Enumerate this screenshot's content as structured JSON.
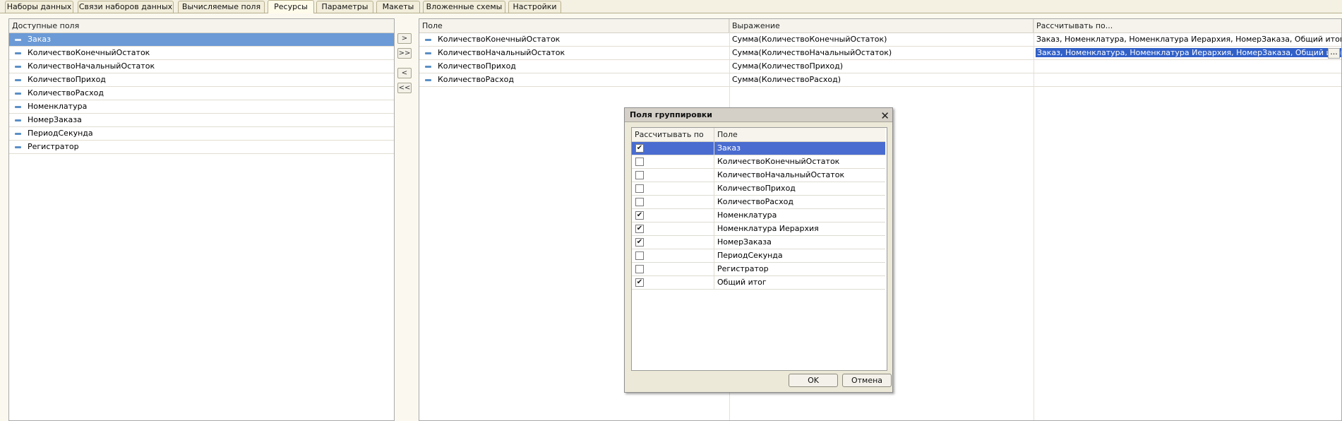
{
  "tabs": [
    {
      "label": "Наборы данных"
    },
    {
      "label": "Связи наборов данных"
    },
    {
      "label": "Вычисляемые поля"
    },
    {
      "label": "Ресурсы"
    },
    {
      "label": "Параметры"
    },
    {
      "label": "Макеты"
    },
    {
      "label": "Вложенные схемы"
    },
    {
      "label": "Настройки"
    }
  ],
  "available_fields": {
    "header": "Доступные поля",
    "items": [
      {
        "label": "Заказ"
      },
      {
        "label": "КоличествоКонечныйОстаток"
      },
      {
        "label": "КоличествоНачальныйОстаток"
      },
      {
        "label": "КоличествоПриход"
      },
      {
        "label": "КоличествоРасход"
      },
      {
        "label": "Номенклатура"
      },
      {
        "label": "НомерЗаказа"
      },
      {
        "label": "ПериодСекунда"
      },
      {
        "label": "Регистратор"
      }
    ]
  },
  "move_buttons": {
    "add": ">",
    "add_all": ">>",
    "remove": "<",
    "remove_all": "<<"
  },
  "resources": {
    "columns": {
      "field": "Поле",
      "expression": "Выражение",
      "calc_by": "Рассчитывать по..."
    },
    "rows": [
      {
        "field": "КоличествоКонечныйОстаток",
        "expression": "Сумма(КоличествоКонечныйОстаток)",
        "calc_by": "Заказ, Номенклатура, Номенклатура Иерархия, НомерЗаказа, Общий итог"
      },
      {
        "field": "КоличествоНачальныйОстаток",
        "expression": "Сумма(КоличествоНачальныйОстаток)",
        "calc_by": "Заказ, Номенклатура, Номенклатура Иерархия, НомерЗаказа, Общий итог"
      },
      {
        "field": "КоличествоПриход",
        "expression": "Сумма(КоличествоПриход)",
        "calc_by": ""
      },
      {
        "field": "КоличествоРасход",
        "expression": "Сумма(КоличествоРасход)",
        "calc_by": ""
      }
    ],
    "ellipsis": "..."
  },
  "dialog": {
    "title": "Поля группировки",
    "col_calc": "Рассчитывать по",
    "col_field": "Поле",
    "rows": [
      {
        "label": "Заказ",
        "checked": true
      },
      {
        "label": "КоличествоКонечныйОстаток",
        "checked": false
      },
      {
        "label": "КоличествоНачальныйОстаток",
        "checked": false
      },
      {
        "label": "КоличествоПриход",
        "checked": false
      },
      {
        "label": "КоличествоРасход",
        "checked": false
      },
      {
        "label": "Номенклатура",
        "checked": true
      },
      {
        "label": "Номенклатура Иерархия",
        "checked": true
      },
      {
        "label": "НомерЗаказа",
        "checked": true
      },
      {
        "label": "ПериодСекунда",
        "checked": false
      },
      {
        "label": "Регистратор",
        "checked": false
      },
      {
        "label": "Общий итог",
        "checked": true
      }
    ],
    "ok": "OK",
    "cancel": "Отмена"
  }
}
